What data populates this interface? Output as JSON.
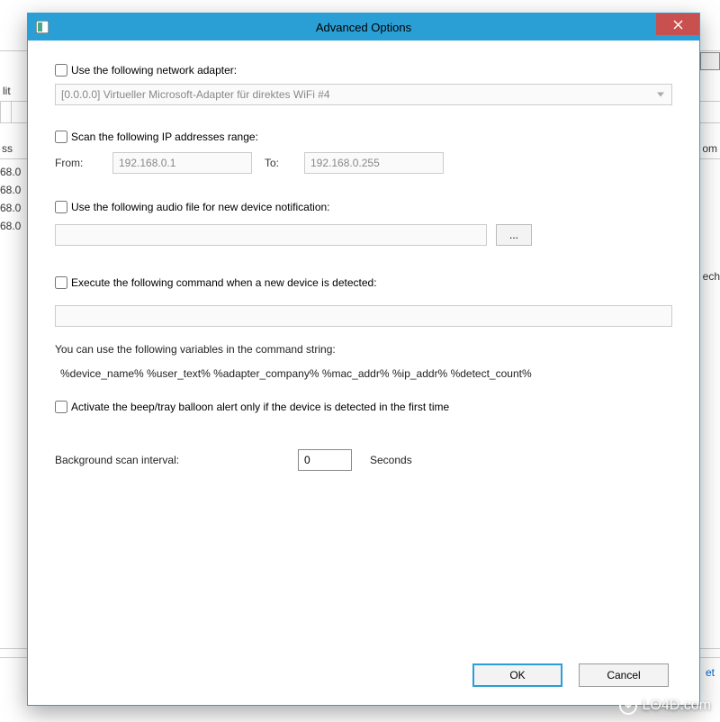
{
  "bg": {
    "menu_edit": "lit",
    "col_ss": "ss",
    "col_om": "om",
    "ip1": "68.0",
    "ip2": "68.0",
    "ip3": "68.0",
    "ip4": "68.0",
    "ech": "ech",
    "link": "et"
  },
  "dialog": {
    "title": "Advanced Options",
    "opt_adapter": {
      "label": "Use the following network adapter:",
      "value": "[0.0.0.0]  Virtueller Microsoft-Adapter für direktes WiFi #4"
    },
    "opt_iprange": {
      "label": "Scan the following IP addresses range:",
      "from_label": "From:",
      "to_label": "To:",
      "from": "192.168.0.1",
      "to": "192.168.0.255"
    },
    "opt_audio": {
      "label": "Use the following audio file for new device notification:",
      "value": "",
      "browse": "..."
    },
    "opt_cmd": {
      "label": "Execute the following command when a new device is detected:",
      "value": "",
      "help": "You can use the following variables in the command string:",
      "vars": "%device_name%  %user_text%  %adapter_company%  %mac_addr%  %ip_addr% %detect_count%"
    },
    "opt_beep": {
      "label": "Activate the beep/tray balloon alert only if the device is detected in the first time"
    },
    "interval": {
      "label": "Background scan interval:",
      "value": "0",
      "unit": "Seconds"
    },
    "buttons": {
      "ok": "OK",
      "cancel": "Cancel"
    }
  },
  "watermark": "LO4D.com"
}
